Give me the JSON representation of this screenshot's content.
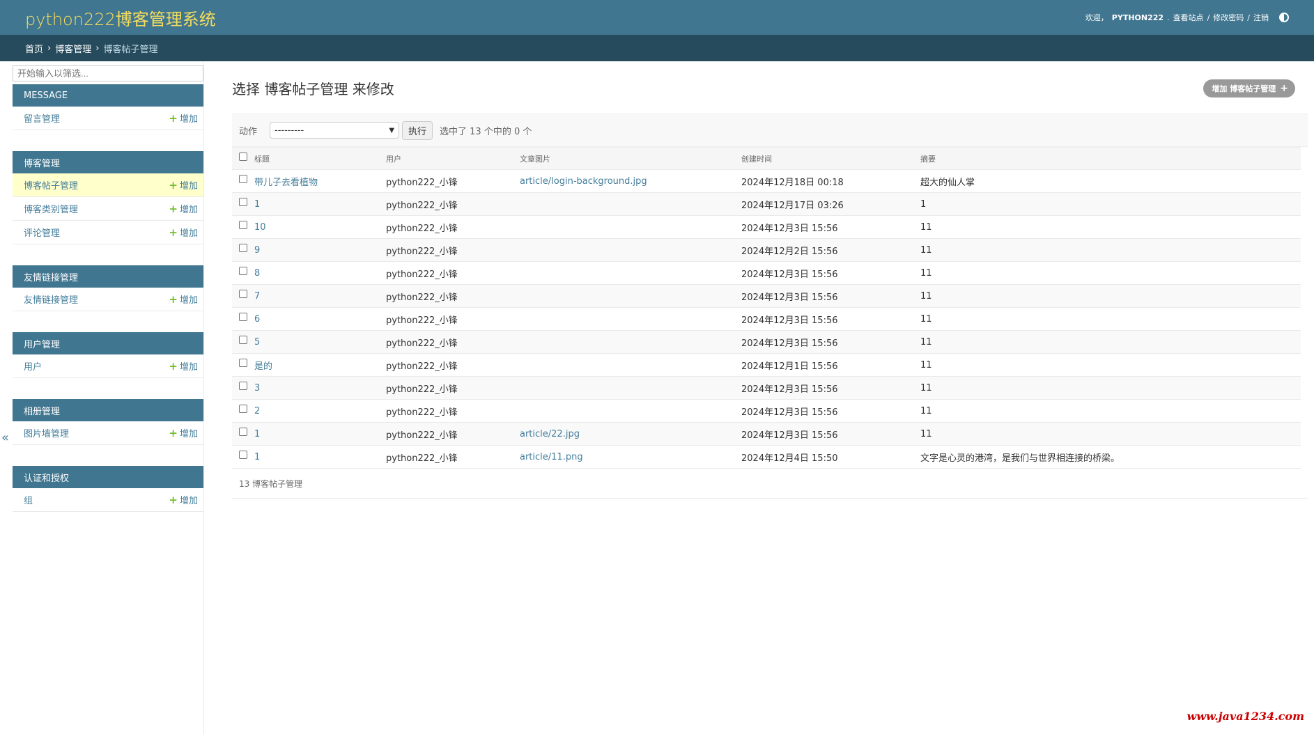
{
  "header": {
    "site_name": "python222博客管理系统",
    "welcome": "欢迎，",
    "username": "PYTHON222",
    "view_site": "查看站点",
    "change_password": "修改密码",
    "logout": "注销",
    "sep": "/",
    "period": ".",
    "theme_icon": "contrast-icon"
  },
  "breadcrumbs": {
    "home": "首页",
    "app": "博客管理",
    "current": "博客帖子管理",
    "sep": "›"
  },
  "sidebar": {
    "filter_placeholder": "开始输入以筛选...",
    "add_label": "增加",
    "plus_glyph": "+",
    "collapse_glyph": "«",
    "modules": [
      {
        "caption": "MESSAGE",
        "models": [
          {
            "label": "留言管理"
          }
        ]
      },
      {
        "caption": "博客管理",
        "models": [
          {
            "label": "博客帖子管理",
            "current": true
          },
          {
            "label": "博客类别管理"
          },
          {
            "label": "评论管理"
          }
        ]
      },
      {
        "caption": "友情链接管理",
        "models": [
          {
            "label": "友情链接管理"
          }
        ]
      },
      {
        "caption": "用户管理",
        "models": [
          {
            "label": "用户"
          }
        ]
      },
      {
        "caption": "相册管理",
        "models": [
          {
            "label": "图片墙管理"
          }
        ]
      },
      {
        "caption": "认证和授权",
        "models": [
          {
            "label": "组"
          }
        ]
      }
    ]
  },
  "main": {
    "title": "选择 博客帖子管理 来修改",
    "add_button": "增加 博客帖子管理",
    "add_glyph": "+",
    "actions_label": "动作",
    "action_selected": "---------",
    "go_button": "执行",
    "selection_counter": "选中了 13 个中的 0 个",
    "columns": [
      "标题",
      "用户",
      "文章图片",
      "创建时间",
      "摘要"
    ],
    "rows": [
      [
        "带儿子去看植物",
        "python222_小锋",
        "article/login-background.jpg",
        "2024年12月18日 00:18",
        "超大的仙人掌"
      ],
      [
        "1",
        "python222_小锋",
        "",
        "2024年12月17日 03:26",
        "1"
      ],
      [
        "10",
        "python222_小锋",
        "",
        "2024年12月3日 15:56",
        "11"
      ],
      [
        "9",
        "python222_小锋",
        "",
        "2024年12月2日 15:56",
        "11"
      ],
      [
        "8",
        "python222_小锋",
        "",
        "2024年12月3日 15:56",
        "11"
      ],
      [
        "7",
        "python222_小锋",
        "",
        "2024年12月3日 15:56",
        "11"
      ],
      [
        "6",
        "python222_小锋",
        "",
        "2024年12月3日 15:56",
        "11"
      ],
      [
        "5",
        "python222_小锋",
        "",
        "2024年12月3日 15:56",
        "11"
      ],
      [
        "是的",
        "python222_小锋",
        "",
        "2024年12月1日 15:56",
        "11"
      ],
      [
        "3",
        "python222_小锋",
        "",
        "2024年12月3日 15:56",
        "11"
      ],
      [
        "2",
        "python222_小锋",
        "",
        "2024年12月3日 15:56",
        "11"
      ],
      [
        "1",
        "python222_小锋",
        "article/22.jpg",
        "2024年12月3日 15:56",
        "11"
      ],
      [
        "1",
        "python222_小锋",
        "article/11.png",
        "2024年12月4日 15:50",
        "文字是心灵的港湾，是我们与世界相连接的桥梁。"
      ]
    ],
    "paginator": "13 博客帖子管理"
  },
  "watermark": "www.java1234.com"
}
